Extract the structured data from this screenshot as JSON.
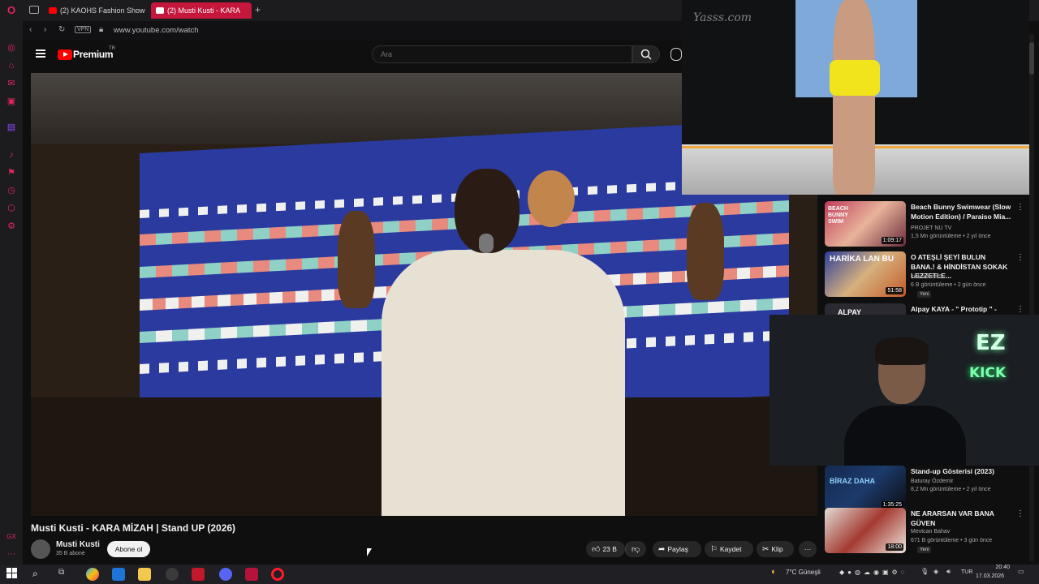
{
  "browser": {
    "tabs": [
      {
        "label": "(2) KAOHS Fashion Show"
      },
      {
        "label": "(2) Musti Kusti - KARA"
      }
    ],
    "new_tab_glyph": "+",
    "vpn_label": "VPN",
    "url": "www.youtube.com/watch"
  },
  "youtube": {
    "logo_text": "Premium",
    "logo_region": "TR",
    "search_placeholder": "Ara"
  },
  "video": {
    "title": "Musti Kusti - KARA MİZAH  | Stand UP (2026)",
    "channel": "Musti Kusti",
    "subscribers": "35 B abone",
    "subscribe_label": "Abone ol",
    "like_count": "23 B",
    "share_label": "Paylaş",
    "save_label": "Kaydet",
    "clip_label": "Klip",
    "more_glyph": "···"
  },
  "pip": {
    "watermark": "Yasss.com"
  },
  "recommendations": [
    {
      "title": "Beach Bunny Swimwear (Slow Motion Edition) / Paraiso Mia...",
      "channel": "PROJET NU TV",
      "meta": "1,5 Mn görüntüleme • 2 yıl önce",
      "duration": "1:09:17",
      "thumb_text": "BEACH BUNNY SWIM"
    },
    {
      "title": "O ATEŞLİ ŞEYİ BULUN BANA.! & HİNDİSTAN SOKAK LEZZETLE...",
      "channel": "kickmeister5",
      "meta": "6 B görüntüleme • 2 gün önce",
      "duration": "51:58",
      "badge": "Yeni",
      "thumb_text": "HARİKA LAN BU"
    },
    {
      "title": "Alpay KAYA - \" Prototip \" -",
      "thumb_text": "ALPAY"
    },
    {
      "title": "Stand-up Gösterisi (2023)",
      "channel": "Baturay Özdemir",
      "meta": "8,2 Mn görüntüleme • 2 yıl önce",
      "duration": "1:35:25",
      "thumb_text": "BİRAZ DAHA"
    },
    {
      "title": "NE ARARSAN VAR BANA GÜVEN",
      "channel": "Mevtcan Bahav",
      "meta": "671 B görüntüleme • 3 gün önce",
      "duration": "18:00",
      "badge": "Yeni"
    }
  ],
  "webcam": {
    "sign_top": "EZ",
    "sign_bottom": "KICK"
  },
  "taskbar": {
    "weather": "7°C  Güneşli",
    "language": "TUR",
    "time": "20:40",
    "date": "17.03.2026"
  },
  "colors": {
    "opera_red": "#c5163c",
    "youtube_red": "#ff0000",
    "background": "#0f0f0f"
  }
}
